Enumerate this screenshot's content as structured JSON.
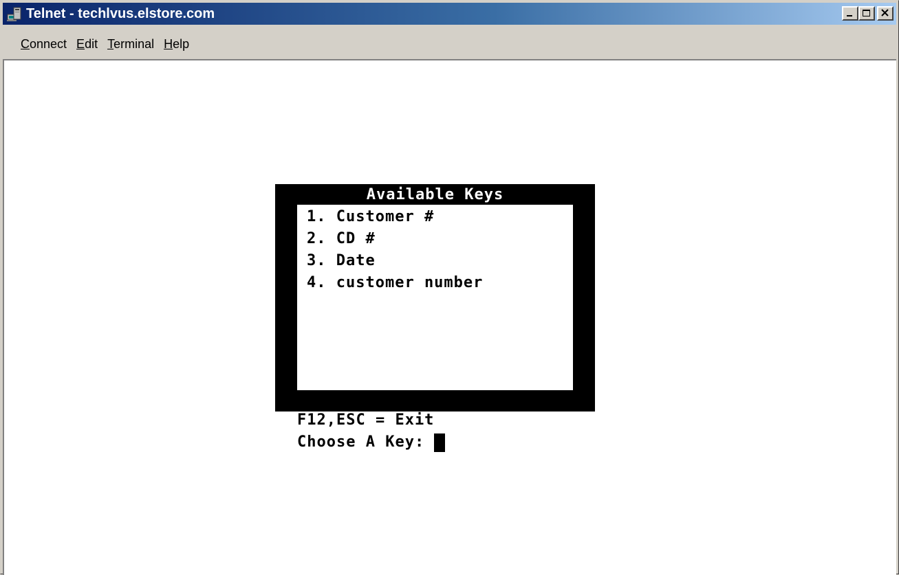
{
  "window": {
    "title": "Telnet - techlvus.elstore.com"
  },
  "menu": {
    "items": [
      {
        "label": "Connect",
        "accel": "C"
      },
      {
        "label": "Edit",
        "accel": "E"
      },
      {
        "label": "Terminal",
        "accel": "T"
      },
      {
        "label": "Help",
        "accel": "H"
      }
    ]
  },
  "terminal": {
    "box_title": "Available Keys",
    "keys": [
      "1. Customer #",
      "2. CD #",
      "3. Date",
      "4. customer number"
    ],
    "exit_hint": "F12,ESC = Exit",
    "prompt": "Choose A Key:",
    "input_value": ""
  },
  "colors": {
    "title_gradient_start": "#0a246a",
    "title_gradient_end": "#a6caf0",
    "terminal_bg": "#ffffff",
    "box_bg": "#000000"
  },
  "icons": {
    "app": "telnet-computer-icon",
    "minimize": "minimize-icon",
    "maximize": "maximize-icon",
    "close": "close-icon"
  }
}
